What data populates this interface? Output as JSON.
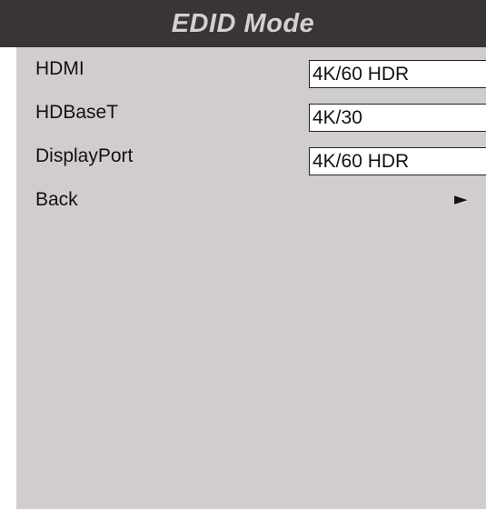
{
  "title": "EDID Mode",
  "menu": {
    "items": [
      {
        "label": "HDMI",
        "value": "4K/60 HDR"
      },
      {
        "label": "HDBaseT",
        "value": "4K/30"
      },
      {
        "label": "DisplayPort",
        "value": "4K/60 HDR"
      },
      {
        "label": "Back",
        "arrow": "►",
        "arrow_icon": "right-triangle-icon"
      }
    ]
  },
  "colors": {
    "title_bar": "#3a3535",
    "title_text": "#d4d0d0",
    "menu_background": "#d2cdcd",
    "value_background": "#ffffff"
  }
}
